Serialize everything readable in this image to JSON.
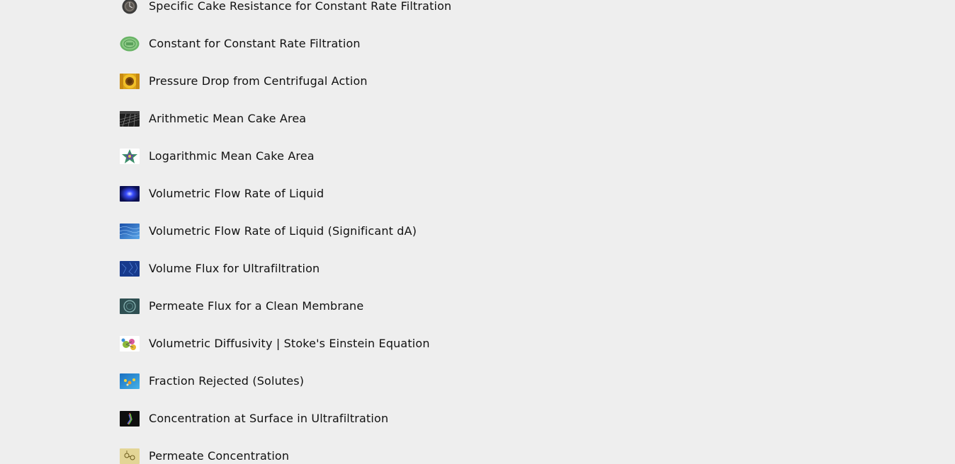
{
  "calculator_list": {
    "items": [
      {
        "label": "Specific Cake Resistance for Constant Rate Filtration",
        "icon": "clock-icon",
        "color": "#2a2a2a"
      },
      {
        "label": "Constant for Constant Rate Filtration",
        "icon": "green-seal-icon",
        "color": "#6fb56a"
      },
      {
        "label": "Pressure Drop from Centrifugal Action",
        "icon": "sunflower-icon",
        "color": "#e7a317"
      },
      {
        "label": "Arithmetic Mean Cake Area",
        "icon": "grid-surface-icon",
        "color": "#3b3b3b"
      },
      {
        "label": "Logarithmic Mean Cake Area",
        "icon": "star-polyhedron-icon",
        "color": "#2c7a8c"
      },
      {
        "label": "Volumetric Flow Rate of Liquid",
        "icon": "blue-glow-icon",
        "color": "#1a2bd8"
      },
      {
        "label": "Volumetric Flow Rate of Liquid (Significant dA)",
        "icon": "water-surface-icon",
        "color": "#2d6fc2"
      },
      {
        "label": "Volume Flux for Ultrafiltration",
        "icon": "blue-pattern-icon",
        "color": "#1d3f9a"
      },
      {
        "label": "Permeate Flux for a Clean Membrane",
        "icon": "circle-ring-icon",
        "color": "#3f6f74"
      },
      {
        "label": "Volumetric Diffusivity | Stoke's Einstein Equation",
        "icon": "molecule-icon",
        "color": "#7fae2c"
      },
      {
        "label": "Fraction Rejected (Solutes)",
        "icon": "particles-icon",
        "color": "#2a86c9"
      },
      {
        "label": "Concentration at Surface in Ultrafiltration",
        "icon": "spectrum-icon",
        "color": "#111111"
      },
      {
        "label": "Permeate Concentration",
        "icon": "yellow-molecule-icon",
        "color": "#d8c77a"
      }
    ]
  }
}
